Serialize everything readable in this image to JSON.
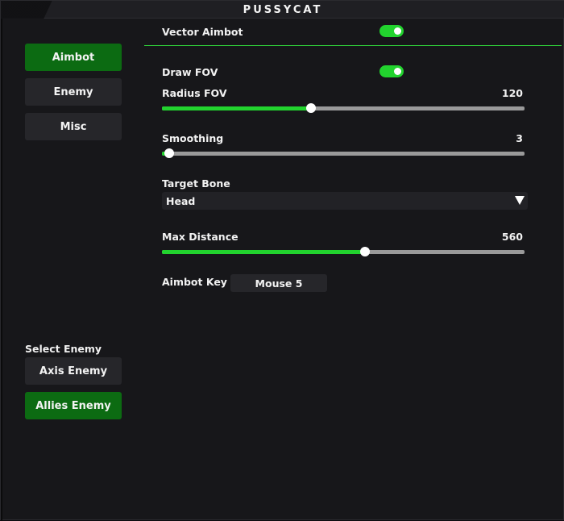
{
  "window": {
    "title": "PUSSYCAT"
  },
  "sidebar": {
    "tabs": [
      {
        "label": "Aimbot",
        "active": true
      },
      {
        "label": "Enemy",
        "active": false
      },
      {
        "label": "Misc",
        "active": false
      }
    ],
    "select_enemy": {
      "label": "Select Enemy",
      "options": [
        {
          "label": "Axis Enemy",
          "active": false
        },
        {
          "label": "Allies Enemy",
          "active": true
        }
      ]
    }
  },
  "main": {
    "header": {
      "label": "Vector Aimbot",
      "enabled": true
    },
    "draw_fov": {
      "label": "Draw FOV",
      "enabled": true
    },
    "radius_fov": {
      "label": "Radius FOV",
      "value": "120",
      "fraction": 0.41
    },
    "smoothing": {
      "label": "Smoothing",
      "value": "3",
      "fraction": 0.02
    },
    "target_bone": {
      "label": "Target Bone",
      "selected": "Head"
    },
    "max_distance": {
      "label": "Max Distance",
      "value": "560",
      "fraction": 0.56
    },
    "aimbot_key": {
      "label": "Aimbot Key",
      "value": "Mouse 5"
    }
  },
  "colors": {
    "accent": "#22d32e",
    "active_button": "#0c6b12",
    "background": "#17171a"
  }
}
